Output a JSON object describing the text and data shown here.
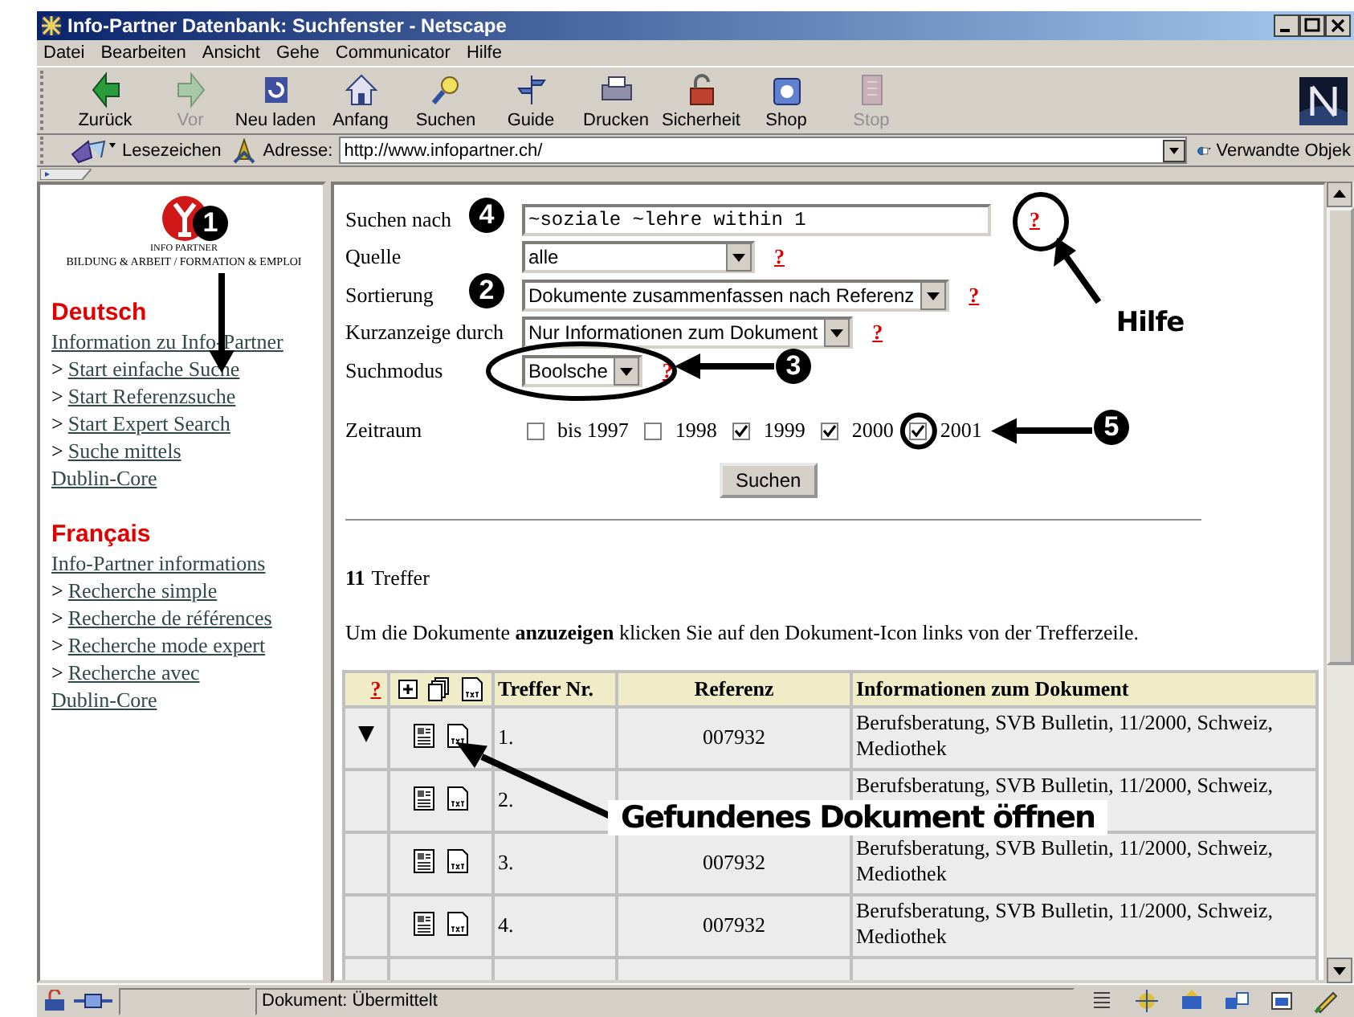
{
  "window": {
    "title": "Info-Partner Datenbank: Suchfenster - Netscape"
  },
  "menu": [
    "Datei",
    "Bearbeiten",
    "Ansicht",
    "Gehe",
    "Communicator",
    "Hilfe"
  ],
  "toolbar": [
    {
      "label": "Zurück",
      "kind": "back",
      "disabled": false
    },
    {
      "label": "Vor",
      "kind": "forward",
      "disabled": true
    },
    {
      "label": "Neu laden",
      "kind": "reload",
      "disabled": false
    },
    {
      "label": "Anfang",
      "kind": "home",
      "disabled": false
    },
    {
      "label": "Suchen",
      "kind": "search",
      "disabled": false
    },
    {
      "label": "Guide",
      "kind": "guide",
      "disabled": false
    },
    {
      "label": "Drucken",
      "kind": "print",
      "disabled": false
    },
    {
      "label": "Sicherheit",
      "kind": "security",
      "disabled": false
    },
    {
      "label": "Shop",
      "kind": "shop",
      "disabled": false
    },
    {
      "label": "Stop",
      "kind": "stop",
      "disabled": true
    }
  ],
  "location_bar": {
    "bookmarks": "Lesezeichen",
    "address_label": "Adresse:",
    "url": "http://www.infopartner.ch/",
    "related": "Verwandte Objek"
  },
  "sidebar": {
    "logo_caption": "INFO PARTNER",
    "logo_subtitle": "BILDUNG & ARBEIT / FORMATION & EMPLOI",
    "sections": [
      {
        "heading": "Deutsch",
        "links": [
          {
            "text": "Information zu Info-Partner"
          },
          {
            "marker": ">",
            "text": "Start einfache Suche"
          },
          {
            "marker": ">",
            "text": "Start Referenzsuche"
          },
          {
            "marker": ">",
            "text": "Start Expert Search"
          },
          {
            "marker": ">",
            "text": "Suche mittels"
          },
          {
            "text": "Dublin-Core"
          }
        ]
      },
      {
        "heading": "Français",
        "links": [
          {
            "text": "Info-Partner informations"
          },
          {
            "marker": ">",
            "text": "Recherche simple"
          },
          {
            "marker": ">",
            "text": "Recherche de références"
          },
          {
            "marker": ">",
            "text": "Recherche mode expert"
          },
          {
            "marker": ">",
            "text": "Recherche avec"
          },
          {
            "text": "Dublin-Core"
          }
        ]
      }
    ]
  },
  "form": {
    "fields": [
      {
        "kind": "text",
        "label": "Suchen nach",
        "value": "~soziale ~lehre within 1",
        "help": "?"
      },
      {
        "kind": "select",
        "label": "Quelle",
        "value": "alle",
        "help": "?"
      },
      {
        "kind": "select",
        "label": "Sortierung",
        "value": "Dokumente zusammenfassen nach Referenz",
        "help": "?"
      },
      {
        "kind": "select",
        "label": "Kurzanzeige durch",
        "value": "Nur Informationen zum Dokument",
        "help": "?"
      },
      {
        "kind": "select",
        "label": "Suchmodus",
        "value": "Boolsche",
        "help": "?"
      }
    ],
    "period": {
      "label": "Zeitraum",
      "options": [
        {
          "label": "bis 1997",
          "checked": false
        },
        {
          "label": "1998",
          "checked": false
        },
        {
          "label": "1999",
          "checked": true
        },
        {
          "label": "2000",
          "checked": true
        },
        {
          "label": "2001",
          "checked": true
        }
      ]
    },
    "submit": "Suchen"
  },
  "results": {
    "count": "11",
    "count_label": "Treffer",
    "instruction": "Um die Dokumente **anzuzeigen** klicken Sie auf den Dokument-Icon links von der Trefferzeile.",
    "columns": [
      {
        "kind": "help",
        "label": "?"
      },
      {
        "kind": "icons"
      },
      {
        "kind": "text",
        "label": "Treffer Nr."
      },
      {
        "kind": "text",
        "label": "Referenz"
      },
      {
        "kind": "text",
        "label": "Informationen zum Dokument"
      }
    ],
    "rows": [
      {
        "expanded": true,
        "number": "1.",
        "reference": "007932",
        "info": "Berufsberatung, SVB Bulletin, 11/2000, Schweiz, Mediothek"
      },
      {
        "expanded": false,
        "number": "2.",
        "info": "Berufsberatung, SVB Bulletin, 11/2000, Schweiz,"
      },
      {
        "expanded": false,
        "number": "3.",
        "reference": "007932",
        "info": "Berufsberatung, SVB Bulletin, 11/2000, Schweiz, Mediothek"
      },
      {
        "expanded": false,
        "number": "4.",
        "reference": "007932",
        "info": "Berufsberatung, SVB Bulletin, 11/2000, Schweiz, Mediothek"
      },
      {
        "expanded": false
      }
    ]
  },
  "annotations": [
    {
      "kind": "badge",
      "text": "1"
    },
    {
      "kind": "badge",
      "text": "4"
    },
    {
      "kind": "badge",
      "text": "2"
    },
    {
      "kind": "badge",
      "text": "3"
    },
    {
      "kind": "badge",
      "text": "5"
    },
    {
      "kind": "label",
      "text": "Hilfe"
    },
    {
      "kind": "label",
      "text": "Gefundenes Dokument öffnen"
    }
  ],
  "status_bar": {
    "text": "Dokument: Übermittelt"
  }
}
